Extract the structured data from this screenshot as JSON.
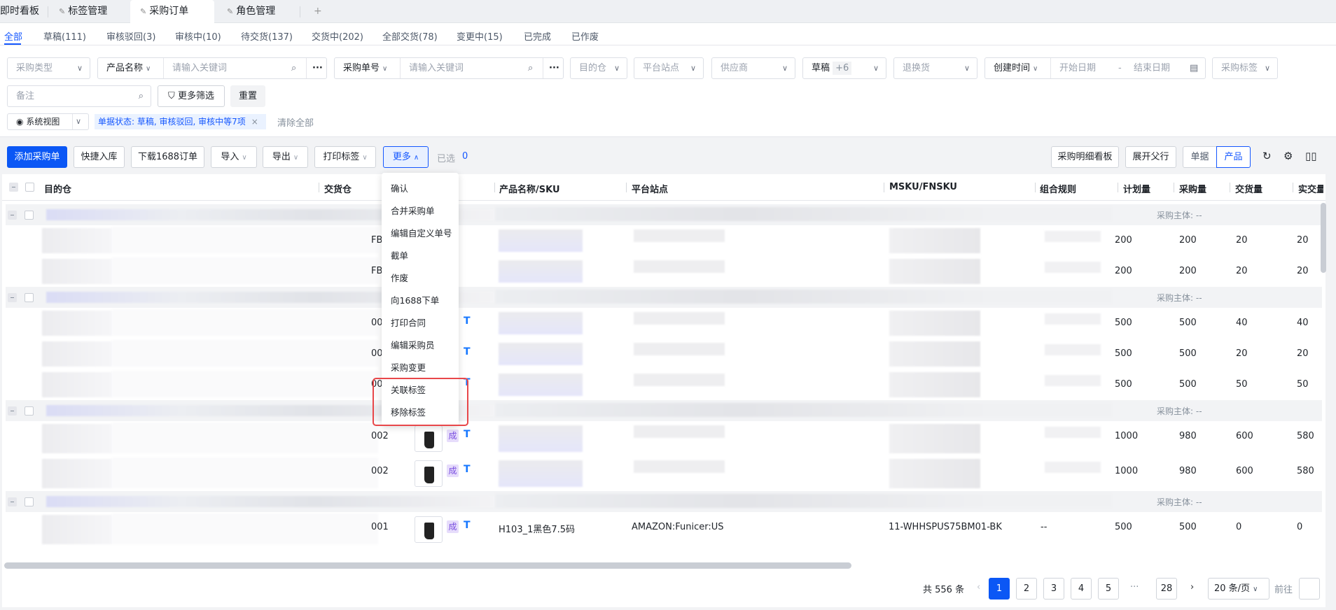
{
  "page_tabs": [
    {
      "label": "即时看板"
    },
    {
      "label": "标签管理"
    },
    {
      "label": "采购订单"
    },
    {
      "label": "角色管理"
    }
  ],
  "add_tab": "+",
  "status_tabs": [
    "全部",
    "草稿(111)",
    "审核驳回(3)",
    "审核中(10)",
    "待交货(137)",
    "交货中(202)",
    "全部交货(78)",
    "变更中(15)",
    "已完成",
    "已作废"
  ],
  "filters": {
    "purchase_type": "采购类型",
    "product_name": "产品名称",
    "keyword_placeholder": "请输入关键词",
    "order_no": "采购单号",
    "target_wh": "目的仓",
    "platform_site": "平台站点",
    "supplier": "供应商",
    "status_value": "草稿",
    "status_more": "+6",
    "return": "退换货",
    "create_time": "创建时间",
    "start_date": "开始日期",
    "date_sep": "-",
    "end_date": "结束日期",
    "purchase_tag": "采购标签",
    "remark": "备注",
    "more_filters": "更多筛选",
    "reset": "重置",
    "system_view": "系统视图",
    "active_chip": "单据状态: 草稿, 审核驳回, 审核中等7项",
    "clear_all": "清除全部"
  },
  "toolbar": {
    "add": "添加采购单",
    "quick_stock": "快捷入库",
    "download_1688": "下载1688订单",
    "import": "导入",
    "export": "导出",
    "print_label": "打印标签",
    "more": "更多",
    "selected_label": "已选",
    "selected_count": "0",
    "detail_board": "采购明细看板",
    "expand_parent": "展开父行",
    "view_doc": "单据",
    "view_product": "产品"
  },
  "columns": [
    "目的仓",
    "交货仓",
    "产品名称/SKU",
    "平台站点",
    "MSKU/FNSKU",
    "组合规则",
    "计划量",
    "采购量",
    "交货量",
    "实交量"
  ],
  "more_menu": [
    "确认",
    "合并采购单",
    "编辑自定义单号",
    "截单",
    "作废",
    "向1688下单",
    "打印合同",
    "编辑采购员",
    "采购变更",
    "关联标签",
    "移除标签"
  ],
  "group_label": "采购主体: --",
  "badge": "成",
  "groups": [
    {
      "rows": [
        {
          "wh": "FBA",
          "q": [
            "200",
            "200",
            "20",
            "20"
          ]
        },
        {
          "wh": "FBA",
          "q": [
            "200",
            "200",
            "20",
            "20"
          ]
        }
      ]
    },
    {
      "rows": [
        {
          "wh": "00",
          "q": [
            "500",
            "500",
            "40",
            "40"
          ],
          "badge": true
        },
        {
          "wh": "00",
          "q": [
            "500",
            "500",
            "20",
            "20"
          ],
          "badge": true
        },
        {
          "wh": "00",
          "q": [
            "500",
            "500",
            "50",
            "50"
          ],
          "badge": true
        }
      ]
    },
    {
      "rows": [
        {
          "wh": "002",
          "q": [
            "1000",
            "980",
            "600",
            "580"
          ],
          "badge": true,
          "img": "sandal"
        },
        {
          "wh": "002",
          "q": [
            "1000",
            "980",
            "600",
            "580"
          ],
          "badge": true,
          "img": "boot"
        }
      ]
    },
    {
      "rows": [
        {
          "wh": "001",
          "q": [
            "500",
            "500",
            "0",
            "0"
          ],
          "badge": true,
          "img": "boot",
          "sku": "H103_1黑色7.5码",
          "site": "AMAZON:Funicer:US",
          "msku": "11-WHHSPUS75BM01-BK",
          "rule": "--"
        }
      ]
    }
  ],
  "pagination": {
    "total": "共 556 条",
    "pages": [
      "1",
      "2",
      "3",
      "4",
      "5"
    ],
    "ellipsis": "···",
    "last": "28",
    "page_size": "20 条/页",
    "goto": "前往"
  },
  "colors": {
    "accent": "#0b57f5",
    "highlight": "#e8474a"
  }
}
